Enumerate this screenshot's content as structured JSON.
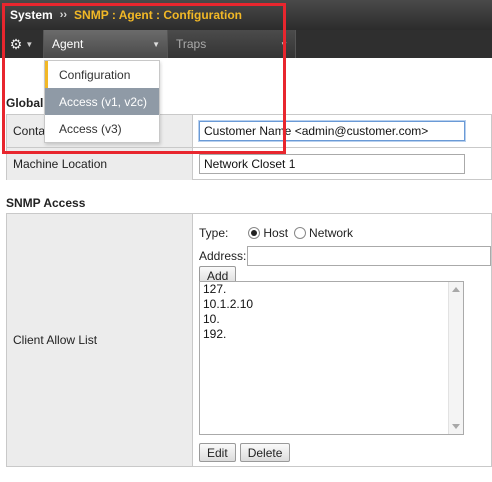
{
  "breadcrumb": {
    "root": "System",
    "separator": "››",
    "current": "SNMP : Agent : Configuration"
  },
  "nav": {
    "gear_icon": "gear-icon",
    "tabs": [
      {
        "label": "Agent",
        "active": true
      },
      {
        "label": "Traps",
        "active": false
      }
    ]
  },
  "agent_menu": {
    "items": [
      {
        "label": "Configuration",
        "state": "current"
      },
      {
        "label": "Access (v1, v2c)",
        "state": "hover"
      },
      {
        "label": "Access (v3)",
        "state": "normal"
      }
    ]
  },
  "global_section": {
    "title": "Global",
    "contact_label": "Conta",
    "contact_value": "Customer Name <admin@customer.com>",
    "location_label": "Machine Location",
    "location_value": "Network Closet 1"
  },
  "snmp_access": {
    "title": "SNMP Access",
    "client_allow_label": "Client Allow List",
    "type_label": "Type:",
    "type_options": [
      {
        "label": "Host",
        "checked": true
      },
      {
        "label": "Network",
        "checked": false
      }
    ],
    "address_label": "Address:",
    "address_value": "",
    "add_button": "Add",
    "allow_list": [
      "127.",
      "10.1.2.10",
      "10.",
      "192."
    ],
    "edit_button": "Edit",
    "delete_button": "Delete"
  },
  "colors": {
    "highlight": "#e8262e",
    "accent": "#f2b826",
    "menu_hover": "#8f9aa6"
  }
}
